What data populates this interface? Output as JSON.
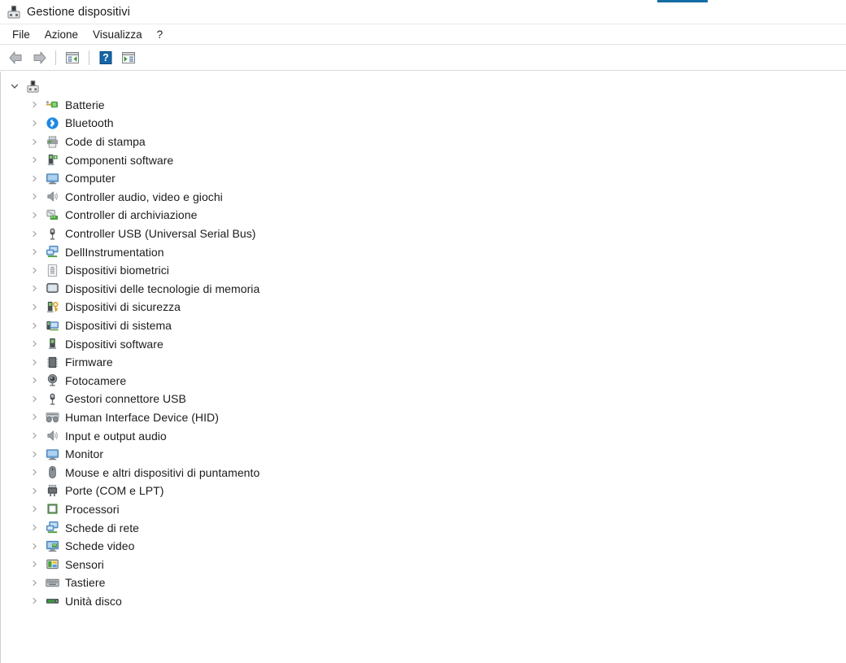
{
  "window": {
    "title": "Gestione dispositivi",
    "title_icon": "device-manager-icon",
    "accent_color": "#156ca5"
  },
  "menubar": {
    "items": [
      {
        "label": "File",
        "name": "menu-file"
      },
      {
        "label": "Azione",
        "name": "menu-azione"
      },
      {
        "label": "Visualizza",
        "name": "menu-visualizza"
      },
      {
        "label": "?",
        "name": "menu-help"
      }
    ]
  },
  "toolbar": {
    "buttons": [
      {
        "icon": "back-arrow-icon",
        "name": "back-button"
      },
      {
        "icon": "forward-arrow-icon",
        "name": "forward-button"
      },
      {
        "icon": "properties-icon",
        "name": "properties-button"
      },
      {
        "icon": "help-icon",
        "name": "help-button"
      },
      {
        "icon": "show-hidden-devices-icon",
        "name": "show-hidden-devices-button"
      }
    ]
  },
  "tree": {
    "root": {
      "label": "",
      "icon": "computer-device-icon",
      "expanded": true,
      "chevron": "chevron-down"
    },
    "nodes": [
      {
        "label": "Batterie",
        "icon": "battery-icon"
      },
      {
        "label": "Bluetooth",
        "icon": "bluetooth-icon"
      },
      {
        "label": "Code di stampa",
        "icon": "printer-icon"
      },
      {
        "label": "Componenti software",
        "icon": "software-component-icon"
      },
      {
        "label": "Computer",
        "icon": "monitor-icon"
      },
      {
        "label": "Controller audio, video e giochi",
        "icon": "speaker-icon"
      },
      {
        "label": "Controller di archiviazione",
        "icon": "storage-controller-icon"
      },
      {
        "label": "Controller USB (Universal Serial Bus)",
        "icon": "usb-icon"
      },
      {
        "label": "DellInstrumentation",
        "icon": "network-adapter-icon"
      },
      {
        "label": "Dispositivi biometrici",
        "icon": "fingerprint-icon"
      },
      {
        "label": "Dispositivi delle tecnologie di memoria",
        "icon": "memory-technology-icon"
      },
      {
        "label": "Dispositivi di sicurezza",
        "icon": "security-key-icon"
      },
      {
        "label": "Dispositivi di sistema",
        "icon": "system-device-icon"
      },
      {
        "label": "Dispositivi software",
        "icon": "software-device-icon"
      },
      {
        "label": "Firmware",
        "icon": "firmware-chip-icon"
      },
      {
        "label": "Fotocamere",
        "icon": "camera-icon"
      },
      {
        "label": "Gestori connettore USB",
        "icon": "usb-connector-icon"
      },
      {
        "label": "Human Interface Device (HID)",
        "icon": "hid-icon"
      },
      {
        "label": "Input e output audio",
        "icon": "speaker-icon"
      },
      {
        "label": "Monitor",
        "icon": "monitor-icon"
      },
      {
        "label": "Mouse e altri dispositivi di puntamento",
        "icon": "mouse-icon"
      },
      {
        "label": "Porte (COM e LPT)",
        "icon": "port-icon"
      },
      {
        "label": "Processori",
        "icon": "processor-icon"
      },
      {
        "label": "Schede di rete",
        "icon": "network-adapter-icon"
      },
      {
        "label": "Schede video",
        "icon": "display-adapter-icon"
      },
      {
        "label": "Sensori",
        "icon": "sensor-icon"
      },
      {
        "label": "Tastiere",
        "icon": "keyboard-icon"
      },
      {
        "label": "Unità disco",
        "icon": "disk-drive-icon"
      }
    ]
  }
}
